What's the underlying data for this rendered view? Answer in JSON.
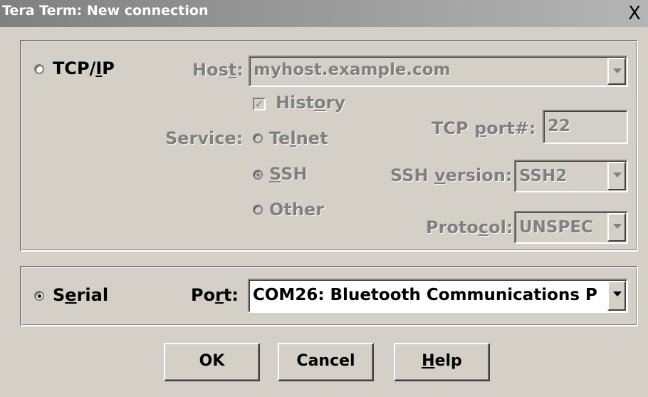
{
  "window": {
    "title": "Tera Term: New connection",
    "close_glyph": "X"
  },
  "tcpip": {
    "label_pre": "TCP/",
    "label_ul": "I",
    "label_post": "P",
    "host_label_pre": "Hos",
    "host_label_ul": "t",
    "host_label_post": ":",
    "host_value": "myhost.example.com",
    "history_label_pre": "Hist",
    "history_label_ul": "o",
    "history_label_post": "ry",
    "history_checked": true,
    "service_label": "Service:",
    "telnet_pre": "Te",
    "telnet_ul": "l",
    "telnet_post": "net",
    "ssh_ul": "S",
    "ssh_post": "SH",
    "other_label": "Other",
    "tcp_port_label_pre": "TCP ",
    "tcp_port_label_ul": "p",
    "tcp_port_label_post": "ort#:",
    "tcp_port_value": "22",
    "ssh_version_label_pre": "SSH ",
    "ssh_version_label_ul": "v",
    "ssh_version_label_post": "ersion:",
    "ssh_version_value": "SSH2",
    "protocol_label_pre": "Proto",
    "protocol_label_ul": "c",
    "protocol_label_post": "ol:",
    "protocol_value": "UNSPEC"
  },
  "serial": {
    "label_pre": "S",
    "label_ul": "e",
    "label_post": "rial",
    "port_label_pre": "Po",
    "port_label_ul": "r",
    "port_label_post": "t:",
    "port_value": "COM26: Bluetooth Communications P"
  },
  "buttons": {
    "ok": "OK",
    "cancel": "Cancel",
    "help_ul": "H",
    "help_post": "elp"
  },
  "colors": {
    "face": "#d4d0c8",
    "disabled_text": "#808080",
    "title_start": "#808080",
    "title_end": "#b5b5b5"
  }
}
